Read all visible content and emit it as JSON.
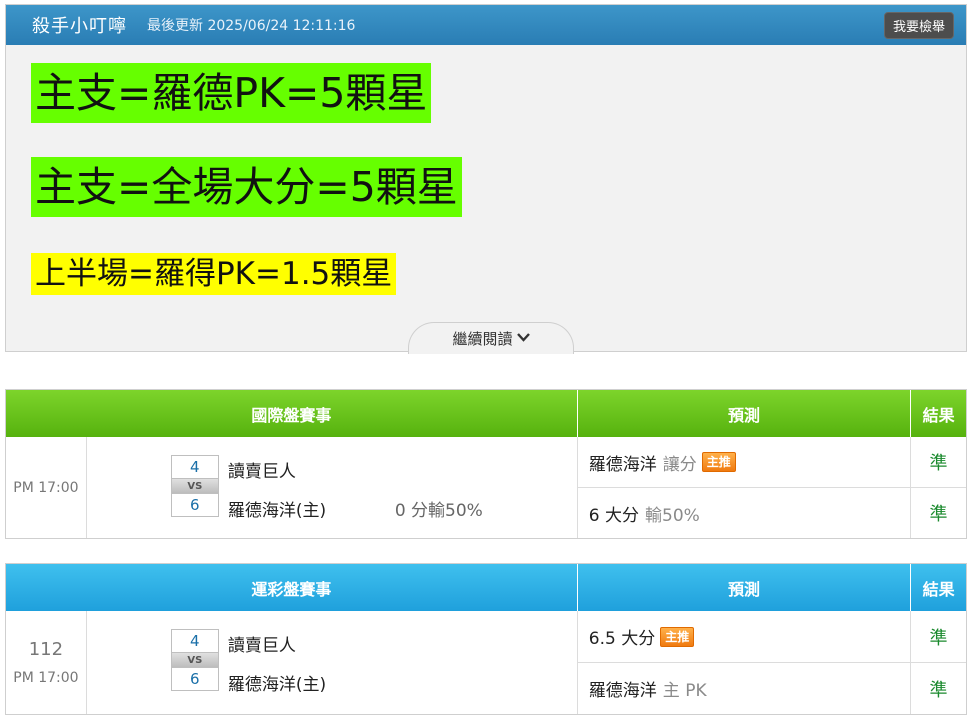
{
  "article": {
    "title": "殺手小叮嚀",
    "updated": "最後更新 2025/06/24 12:11:16",
    "report_label": "我要檢舉",
    "lines": [
      "主支=羅德PK=5顆星",
      "主支=全場大分=5顆星",
      "上半場=羅得PK=1.5顆星"
    ],
    "more_label": "繼續閱讀",
    "highlight_colors": {
      "green": "#66ff00",
      "yellow": "#ffff00"
    }
  },
  "tables": [
    {
      "header": {
        "event": "國際盤賽事",
        "predict": "預測",
        "result": "結果"
      },
      "match": {
        "number": "",
        "time": "PM 17:00",
        "home_score": "4",
        "away_score": "6",
        "vs": "VS",
        "team_a": "讀賣巨人",
        "team_b": "羅德海洋(主)",
        "handicap": "0 分輸50%"
      },
      "predictions": [
        {
          "main": "羅德海洋",
          "detail": "讓分",
          "badge": "主推",
          "result": "準"
        },
        {
          "main": "6 大分",
          "detail": "輸50%",
          "badge": "",
          "result": "準"
        }
      ]
    },
    {
      "header": {
        "event": "運彩盤賽事",
        "predict": "預測",
        "result": "結果"
      },
      "match": {
        "number": "112",
        "time": "PM 17:00",
        "home_score": "4",
        "away_score": "6",
        "vs": "VS",
        "team_a": "讀賣巨人",
        "team_b": "羅德海洋(主)",
        "handicap": ""
      },
      "predictions": [
        {
          "main": "6.5 大分",
          "detail": "",
          "badge": "主推",
          "result": "準"
        },
        {
          "main": "羅德海洋",
          "detail": "主 PK",
          "badge": "",
          "result": "準"
        }
      ]
    }
  ]
}
